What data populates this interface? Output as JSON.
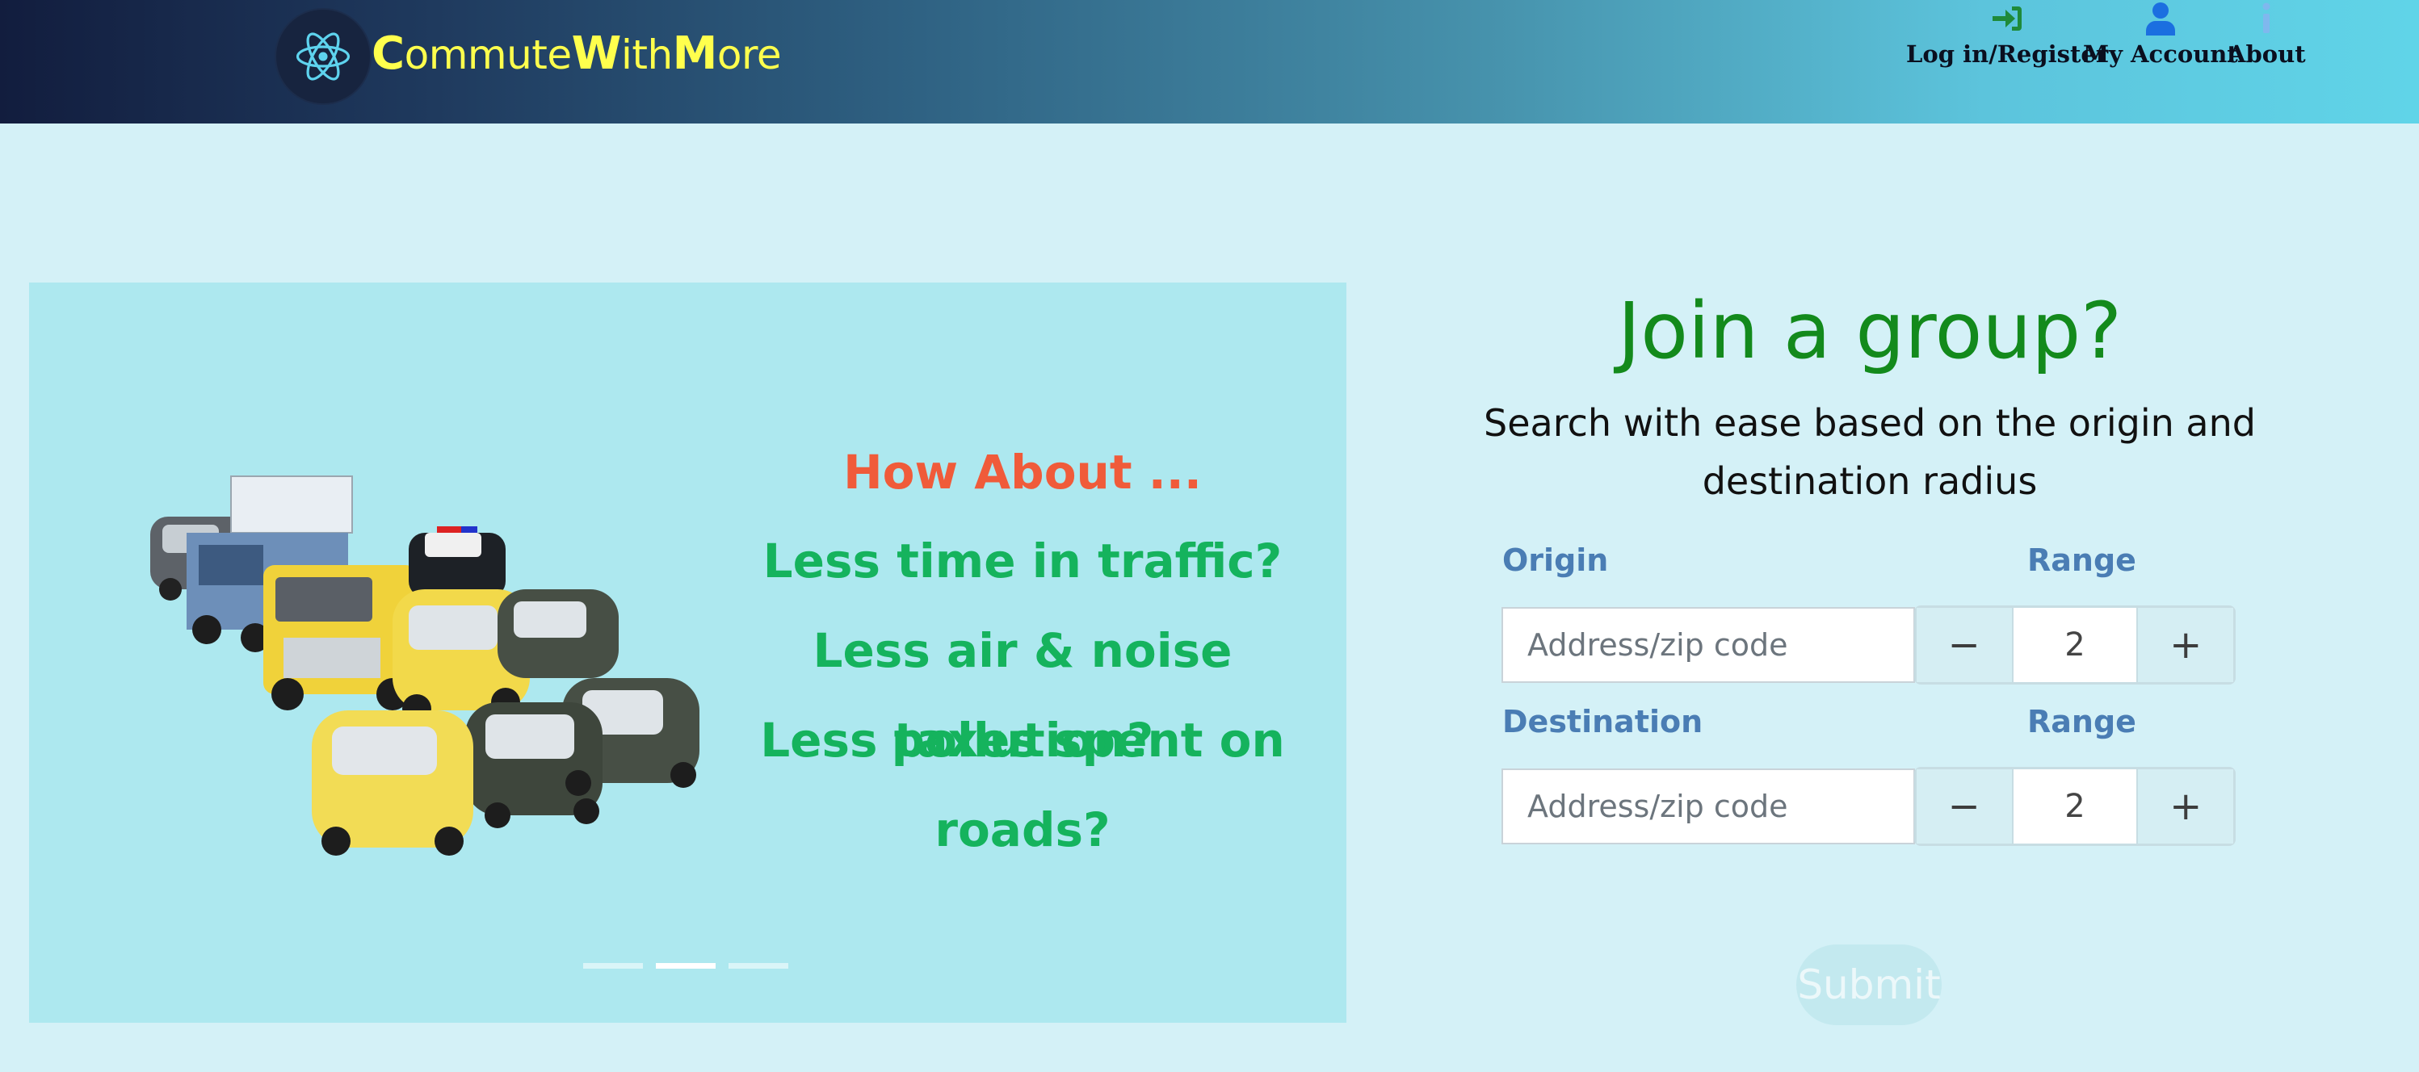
{
  "navbar": {
    "brand": {
      "parts": [
        {
          "text": "C",
          "cap": true
        },
        {
          "text": "ommute",
          "cap": false
        },
        {
          "text": "W",
          "cap": true
        },
        {
          "text": "ith",
          "cap": false
        },
        {
          "text": "M",
          "cap": true
        },
        {
          "text": "ore",
          "cap": false
        }
      ]
    },
    "links": [
      {
        "label": "Log in/Register",
        "icon": "sign-in-icon",
        "icon_color": "#1f8a3a"
      },
      {
        "label": "My Account",
        "icon": "user-icon",
        "icon_color": "#1b6fe0"
      },
      {
        "label": "About",
        "icon": "info-icon",
        "icon_color": "#7fb8ee"
      }
    ]
  },
  "carousel": {
    "heading": "How About ...",
    "lines": [
      "Less time in traffic?",
      "Less air & noise pollution?",
      "Less taxes spent on roads?"
    ],
    "indicators": {
      "count": 3,
      "active": 1
    }
  },
  "search": {
    "title": "Join a group?",
    "subtitle": "Search with ease based on the origin and destination radius",
    "origin": {
      "label": "Origin",
      "placeholder": "Address/zip code",
      "range_label": "Range",
      "range_value": "2"
    },
    "destination": {
      "label": "Destination",
      "placeholder": "Address/zip code",
      "range_label": "Range",
      "range_value": "2"
    },
    "decrement_symbol": "−",
    "increment_symbol": "+",
    "submit_label": "Submit"
  },
  "colors": {
    "brand_yellow": "#ffff4d",
    "title_green": "#138a1c",
    "label_blue": "#4a7db4",
    "heading_orange": "#f05b3a",
    "slide_green": "#15b35d"
  }
}
